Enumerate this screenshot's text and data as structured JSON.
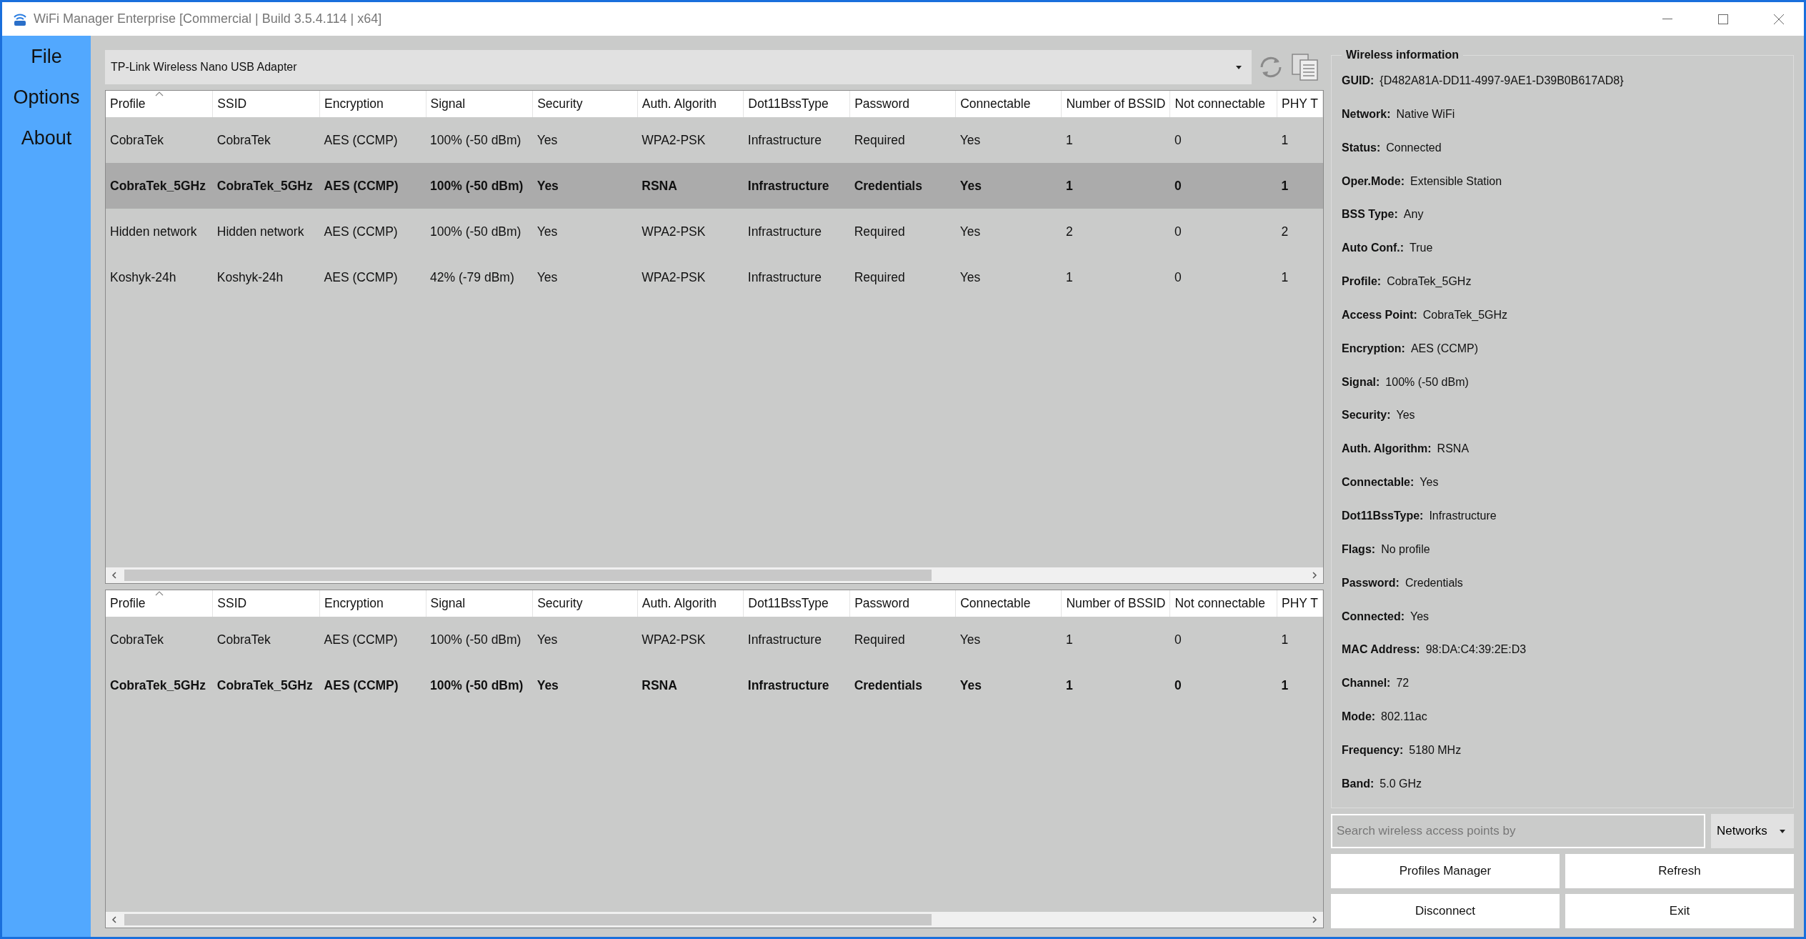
{
  "window": {
    "title": "WiFi Manager Enterprise [Commercial | Build 3.5.4.114 | x64]"
  },
  "menu": [
    {
      "label": "File"
    },
    {
      "label": "Options"
    },
    {
      "label": "About"
    }
  ],
  "adapter": {
    "value": "TP-Link Wireless Nano USB Adapter"
  },
  "networks_table": {
    "columns": [
      {
        "label": "Profile",
        "sorted": true
      },
      {
        "label": "SSID",
        "sorted": false
      },
      {
        "label": "Encryption",
        "sorted": false
      },
      {
        "label": "Signal",
        "sorted": false
      },
      {
        "label": "Security",
        "sorted": false
      },
      {
        "label": "Auth. Algorith",
        "sorted": false
      },
      {
        "label": "Dot11BssType",
        "sorted": false
      },
      {
        "label": "Password",
        "sorted": false
      },
      {
        "label": "Connectable",
        "sorted": false
      },
      {
        "label": "Number of BSSID",
        "sorted": false
      },
      {
        "label": "Not connectable",
        "sorted": false
      },
      {
        "label": "PHY T",
        "sorted": false
      }
    ],
    "rows": [
      {
        "connected": false,
        "selected": false,
        "cells": [
          "CobraTek",
          "CobraTek",
          "AES (CCMP)",
          "100% (-50 dBm)",
          "Yes",
          "WPA2-PSK",
          "Infrastructure",
          "Required",
          "Yes",
          "1",
          "0",
          "1"
        ]
      },
      {
        "connected": true,
        "selected": true,
        "cells": [
          "CobraTek_5GHz",
          "CobraTek_5GHz",
          "AES (CCMP)",
          "100% (-50 dBm)",
          "Yes",
          "RSNA",
          "Infrastructure",
          "Credentials",
          "Yes",
          "1",
          "0",
          "1"
        ]
      },
      {
        "connected": false,
        "selected": false,
        "cells": [
          "Hidden network",
          "Hidden network",
          "AES (CCMP)",
          "100% (-50 dBm)",
          "Yes",
          "WPA2-PSK",
          "Infrastructure",
          "Required",
          "Yes",
          "2",
          "0",
          "2"
        ]
      },
      {
        "connected": false,
        "selected": false,
        "cells": [
          "Koshyk-24h",
          "Koshyk-24h",
          "AES (CCMP)",
          "42% (-79 dBm)",
          "Yes",
          "WPA2-PSK",
          "Infrastructure",
          "Required",
          "Yes",
          "1",
          "0",
          "1"
        ]
      }
    ]
  },
  "profiles_table": {
    "columns": [
      {
        "label": "Profile",
        "sorted": true
      },
      {
        "label": "SSID",
        "sorted": false
      },
      {
        "label": "Encryption",
        "sorted": false
      },
      {
        "label": "Signal",
        "sorted": false
      },
      {
        "label": "Security",
        "sorted": false
      },
      {
        "label": "Auth. Algorith",
        "sorted": false
      },
      {
        "label": "Dot11BssType",
        "sorted": false
      },
      {
        "label": "Password",
        "sorted": false
      },
      {
        "label": "Connectable",
        "sorted": false
      },
      {
        "label": "Number of BSSID",
        "sorted": false
      },
      {
        "label": "Not connectable",
        "sorted": false
      },
      {
        "label": "PHY T",
        "sorted": false
      }
    ],
    "rows": [
      {
        "connected": false,
        "selected": false,
        "cells": [
          "CobraTek",
          "CobraTek",
          "AES (CCMP)",
          "100% (-50 dBm)",
          "Yes",
          "WPA2-PSK",
          "Infrastructure",
          "Required",
          "Yes",
          "1",
          "0",
          "1"
        ]
      },
      {
        "connected": true,
        "selected": false,
        "cells": [
          "CobraTek_5GHz",
          "CobraTek_5GHz",
          "AES (CCMP)",
          "100% (-50 dBm)",
          "Yes",
          "RSNA",
          "Infrastructure",
          "Credentials",
          "Yes",
          "1",
          "0",
          "1"
        ]
      }
    ]
  },
  "wireless_information": {
    "title": "Wireless information",
    "fields": [
      {
        "label": "GUID:",
        "value": "{D482A81A-DD11-4997-9AE1-D39B0B617AD8}"
      },
      {
        "label": "Network:",
        "value": "Native WiFi"
      },
      {
        "label": "Status:",
        "value": "Connected"
      },
      {
        "label": "Oper.Mode:",
        "value": "Extensible Station"
      },
      {
        "label": "BSS Type:",
        "value": "Any"
      },
      {
        "label": "Auto Conf.:",
        "value": "True"
      },
      {
        "label": "Profile:",
        "value": "CobraTek_5GHz"
      },
      {
        "label": "Access Point:",
        "value": "CobraTek_5GHz"
      },
      {
        "label": "Encryption:",
        "value": "AES (CCMP)"
      },
      {
        "label": "Signal:",
        "value": "100% (-50 dBm)"
      },
      {
        "label": "Security:",
        "value": "Yes"
      },
      {
        "label": "Auth. Algorithm:",
        "value": "RSNA"
      },
      {
        "label": "Connectable:",
        "value": "Yes"
      },
      {
        "label": "Dot11BssType:",
        "value": "Infrastructure"
      },
      {
        "label": "Flags:",
        "value": "No profile"
      },
      {
        "label": "Password:",
        "value": "Credentials"
      },
      {
        "label": "Connected:",
        "value": "Yes"
      },
      {
        "label": "MAC Address:",
        "value": "98:DA:C4:39:2E:D3"
      },
      {
        "label": "Channel:",
        "value": "72"
      },
      {
        "label": "Mode:",
        "value": "802.11ac"
      },
      {
        "label": "Frequency:",
        "value": "5180 MHz"
      },
      {
        "label": "Band:",
        "value": "5.0 GHz"
      }
    ]
  },
  "search": {
    "placeholder": "Search wireless access points by"
  },
  "filter": {
    "value": "Networks"
  },
  "buttons": [
    "Profiles Manager",
    "Refresh",
    "Disconnect",
    "Exit"
  ]
}
